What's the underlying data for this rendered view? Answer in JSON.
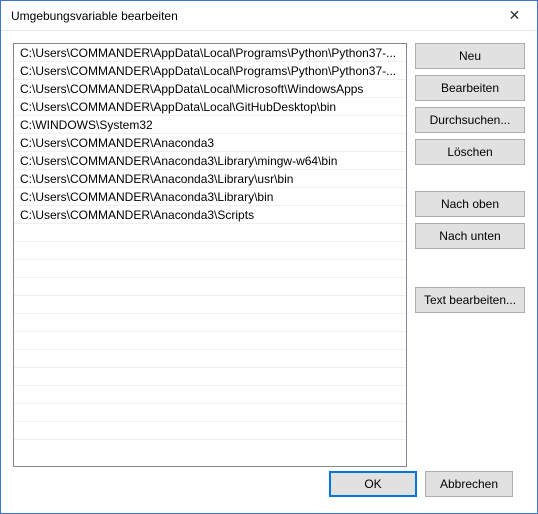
{
  "window": {
    "title": "Umgebungsvariable bearbeiten"
  },
  "list": {
    "items": [
      "C:\\Users\\COMMANDER\\AppData\\Local\\Programs\\Python\\Python37-...",
      "C:\\Users\\COMMANDER\\AppData\\Local\\Programs\\Python\\Python37-...",
      "C:\\Users\\COMMANDER\\AppData\\Local\\Microsoft\\WindowsApps",
      "C:\\Users\\COMMANDER\\AppData\\Local\\GitHubDesktop\\bin",
      "C:\\WINDOWS\\System32",
      "C:\\Users\\COMMANDER\\Anaconda3",
      "C:\\Users\\COMMANDER\\Anaconda3\\Library\\mingw-w64\\bin",
      "C:\\Users\\COMMANDER\\Anaconda3\\Library\\usr\\bin",
      "C:\\Users\\COMMANDER\\Anaconda3\\Library\\bin",
      "C:\\Users\\COMMANDER\\Anaconda3\\Scripts"
    ]
  },
  "buttons": {
    "new": "Neu",
    "edit": "Bearbeiten",
    "browse": "Durchsuchen...",
    "delete": "Löschen",
    "move_up": "Nach oben",
    "move_down": "Nach unten",
    "edit_text": "Text bearbeiten...",
    "ok": "OK",
    "cancel": "Abbrechen"
  }
}
